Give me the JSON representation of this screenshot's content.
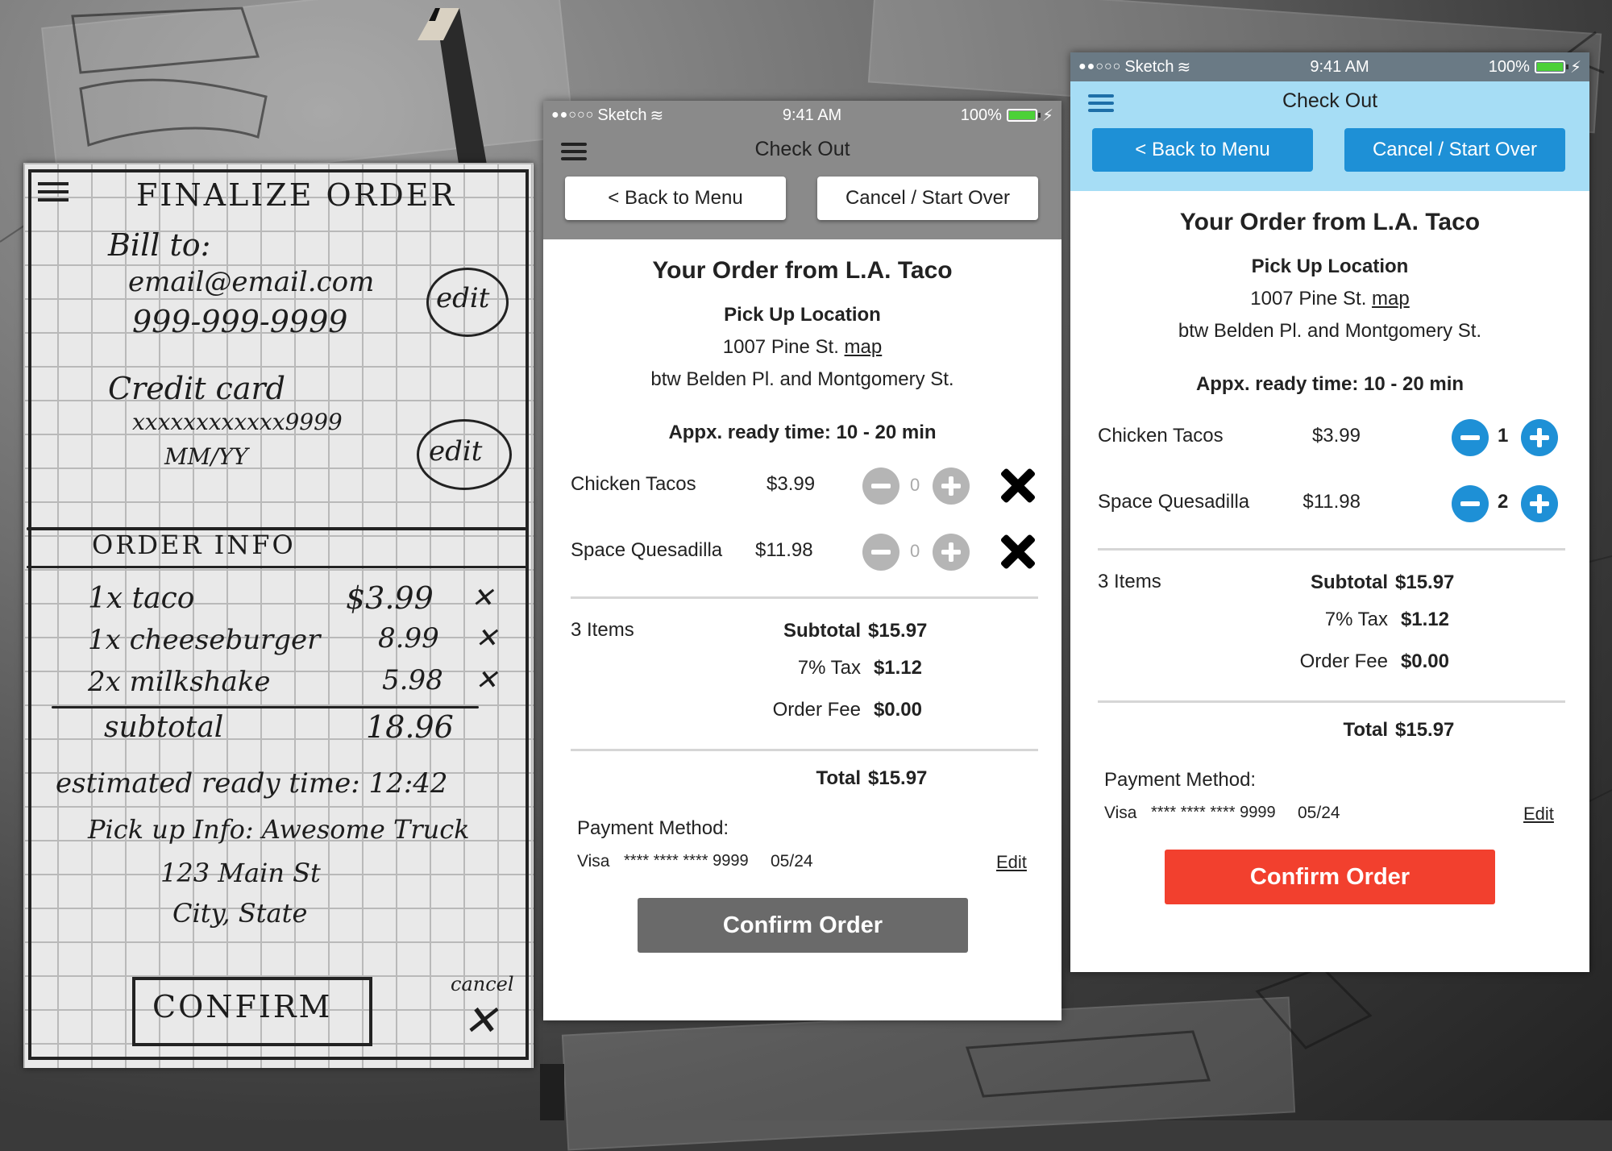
{
  "sketch": {
    "title": "FINALIZE ORDER",
    "bill_to": "Bill to:",
    "email": "email@email.com",
    "phone": "999-999-9999",
    "edit1": "edit",
    "credit_card": "Credit card",
    "card_number": "xxxxxxxxxxxx9999",
    "expiry": "MM/YY",
    "edit2": "edit",
    "order_info": "ORDER INFO",
    "items": [
      {
        "name": "1x taco",
        "price": "$3.99",
        "x": "✕"
      },
      {
        "name": "1x cheeseburger",
        "price": "8.99",
        "x": "✕"
      },
      {
        "name": "2x milkshake",
        "price": "5.98",
        "x": "✕"
      }
    ],
    "subtotal_label": "subtotal",
    "subtotal_value": "18.96",
    "ready_time": "estimated ready time: 12:42",
    "pickup": "Pick up Info: Awesome Truck",
    "address1": "123 Main St",
    "address2": "City, State",
    "confirm": "CONFIRM",
    "cancel": "cancel",
    "cancel_x": "✕"
  },
  "gray_phone": {
    "status": {
      "carrier": "Sketch",
      "time": "9:41 AM",
      "battery": "100%"
    },
    "nav": {
      "title": "Check Out",
      "back": "< Back to Menu",
      "cancel": "Cancel / Start Over"
    },
    "order_title": "Your Order from L.A. Taco",
    "pickup_label": "Pick Up Location",
    "address": "1007 Pine St.",
    "map": "map",
    "cross_streets": "btw Belden Pl. and Montgomery St.",
    "ready": "Appx. ready time: 10 - 20 min",
    "items": [
      {
        "name": "Chicken Tacos",
        "price": "$3.99",
        "qty": "0"
      },
      {
        "name": "Space Quesadilla",
        "price": "$11.98",
        "qty": "0"
      }
    ],
    "item_count": "3 Items",
    "subtotal_label": "Subtotal",
    "subtotal": "$15.97",
    "tax_label": "7% Tax",
    "tax": "$1.12",
    "fee_label": "Order Fee",
    "fee": "$0.00",
    "total_label": "Total",
    "total": "$15.97",
    "payment_label": "Payment Method:",
    "card_type": "Visa",
    "card_number": "**** **** **** 9999",
    "card_exp": "05/24",
    "edit": "Edit",
    "confirm": "Confirm Order"
  },
  "blue_phone": {
    "status": {
      "carrier": "Sketch",
      "time": "9:41 AM",
      "battery": "100%"
    },
    "nav": {
      "title": "Check Out",
      "back": "< Back to Menu",
      "cancel": "Cancel / Start Over"
    },
    "order_title": "Your Order from L.A. Taco",
    "pickup_label": "Pick Up Location",
    "address": "1007 Pine St.",
    "map": "map",
    "cross_streets": "btw Belden Pl. and Montgomery St.",
    "ready": "Appx. ready time: 10 - 20 min",
    "items": [
      {
        "name": "Chicken Tacos",
        "price": "$3.99",
        "qty": "1"
      },
      {
        "name": "Space Quesadilla",
        "price": "$11.98",
        "qty": "2"
      }
    ],
    "item_count": "3 Items",
    "subtotal_label": "Subtotal",
    "subtotal": "$15.97",
    "tax_label": "7% Tax",
    "tax": "$1.12",
    "fee_label": "Order Fee",
    "fee": "$0.00",
    "total_label": "Total",
    "total": "$15.97",
    "payment_label": "Payment Method:",
    "card_type": "Visa",
    "card_number": "**** **** **** 9999",
    "card_exp": "05/24",
    "edit": "Edit",
    "confirm": "Confirm Order"
  },
  "colors": {
    "gray_nav": "#8a8a8a",
    "gray_button": "#6a6a6a",
    "gray_qty": "#b5b5b5",
    "blue_nav": "#a6ddf5",
    "blue_button": "#1e90d6",
    "blue_qty": "#1e90d6",
    "confirm_red": "#f2402e"
  }
}
